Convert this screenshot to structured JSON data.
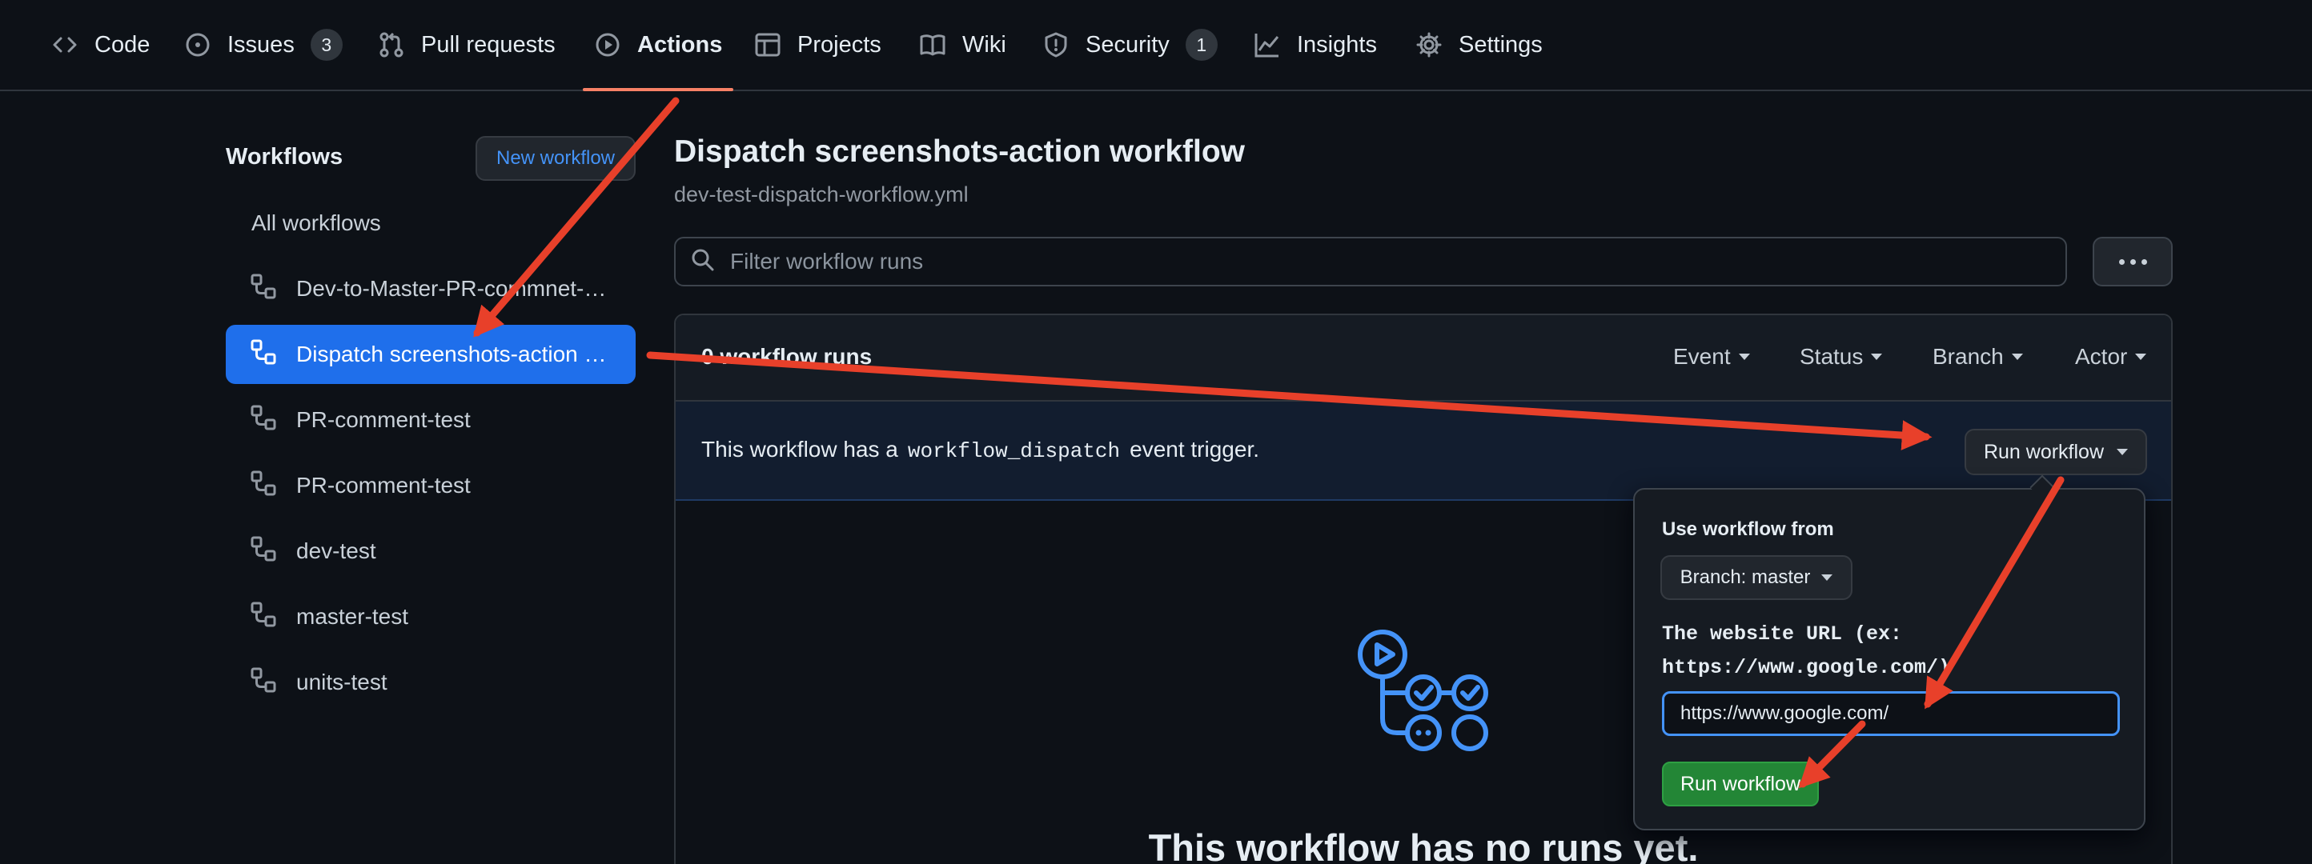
{
  "nav": {
    "tabs": [
      {
        "label": "Code",
        "icon": "code-icon"
      },
      {
        "label": "Issues",
        "icon": "issue-opened-icon",
        "count": "3"
      },
      {
        "label": "Pull requests",
        "icon": "git-pull-request-icon"
      },
      {
        "label": "Actions",
        "icon": "play-icon",
        "active": true
      },
      {
        "label": "Projects",
        "icon": "table-icon"
      },
      {
        "label": "Wiki",
        "icon": "book-icon"
      },
      {
        "label": "Security",
        "icon": "shield-icon",
        "count": "1"
      },
      {
        "label": "Insights",
        "icon": "graph-icon"
      },
      {
        "label": "Settings",
        "icon": "gear-icon"
      }
    ]
  },
  "sidebar": {
    "title": "Workflows",
    "new_workflow_label": "New workflow",
    "all_workflows_label": "All workflows",
    "workflows": [
      {
        "label": "Dev-to-Master-PR-commnet-test"
      },
      {
        "label": "Dispatch screenshots-action workflow",
        "selected": true
      },
      {
        "label": "PR-comment-test"
      },
      {
        "label": "PR-comment-test"
      },
      {
        "label": "dev-test"
      },
      {
        "label": "master-test"
      },
      {
        "label": "units-test"
      }
    ]
  },
  "main": {
    "title": "Dispatch screenshots-action workflow",
    "filename": "dev-test-dispatch-workflow.yml",
    "filter_placeholder": "Filter workflow runs",
    "runs_count": "0 workflow runs",
    "filters": {
      "event": "Event",
      "status": "Status",
      "branch": "Branch",
      "actor": "Actor"
    },
    "dispatch_prefix": "This workflow has a",
    "dispatch_code": "workflow_dispatch",
    "dispatch_suffix": "event trigger.",
    "run_workflow_label": "Run workflow",
    "empty_title": "This workflow has no runs yet."
  },
  "popover": {
    "use_from_label": "Use workflow from",
    "branch_label": "Branch: master",
    "url_label_line1": "The website URL (ex:",
    "url_label_line2": "https://www.google.com/)",
    "url_value": "https://www.google.com/",
    "submit_label": "Run workflow"
  },
  "colors": {
    "accent": "#1f6feb",
    "tab_underline": "#f78166",
    "success": "#238636",
    "annotation_arrow": "#e8402a"
  }
}
